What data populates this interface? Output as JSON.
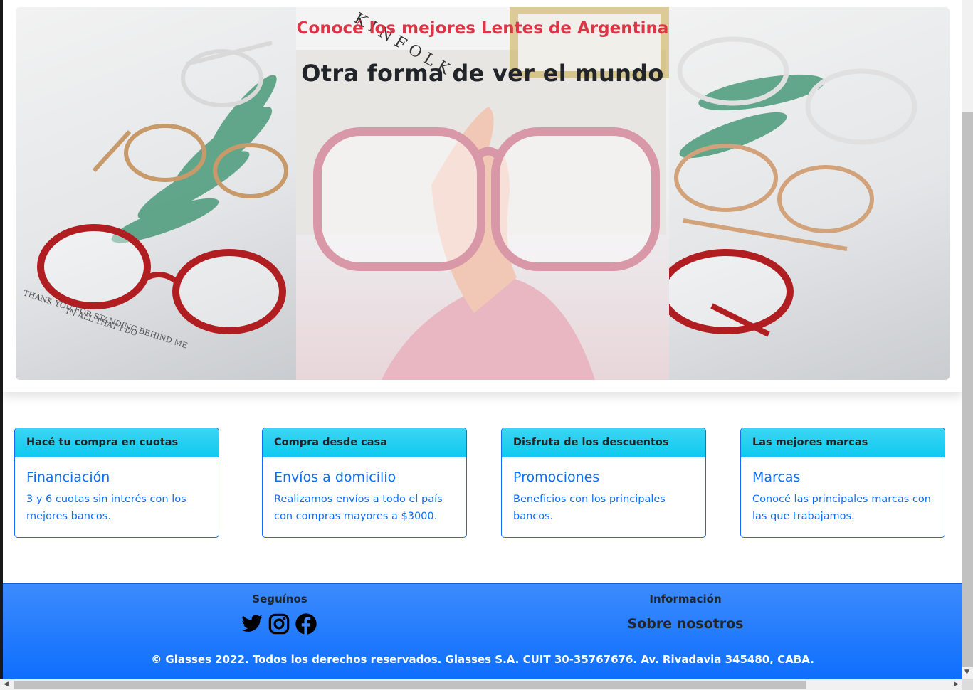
{
  "hero": {
    "title": "Conocé los mejores Lentes de Argentina",
    "heading": "Otra forma de ver el mundo"
  },
  "cards": [
    {
      "header": "Hacé tu compra en cuotas",
      "title": "Financiación",
      "text": "3 y 6 cuotas sin interés con los mejores bancos."
    },
    {
      "header": "Compra desde casa",
      "title": "Envíos a domicilio",
      "text": "Realizamos envíos a todo el país con compras mayores a $3000."
    },
    {
      "header": "Disfruta de los descuentos",
      "title": "Promociones",
      "text": "Beneficios con los principales bancos."
    },
    {
      "header": "Las mejores marcas",
      "title": "Marcas",
      "text": "Conocé las principales marcas con las que trabajamos."
    }
  ],
  "footer": {
    "follow_title": "Seguínos",
    "social": [
      {
        "icon": "twitter-icon"
      },
      {
        "icon": "instagram-icon"
      },
      {
        "icon": "facebook-icon"
      }
    ],
    "info_title": "Información",
    "about_label": "Sobre nosotros",
    "copyright": "© Glasses 2022. Todos los derechos reservados. Glasses S.A. CUIT 30-35767676. Av. Rivadavia 345480, CABA."
  },
  "colors": {
    "accent_red": "#dc3545",
    "primary_blue": "#0d6efd",
    "info_cyan": "#0dcaf0"
  }
}
